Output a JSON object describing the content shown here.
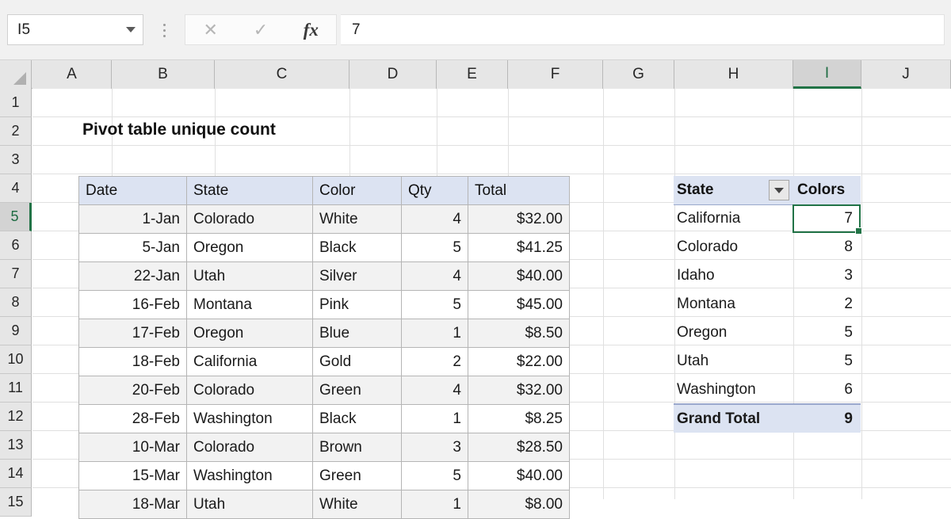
{
  "app": {
    "name_box_value": "I5",
    "formula_bar_value": "7",
    "cancel_icon": "close-icon",
    "confirm_icon": "check-icon",
    "function_icon": "fx-icon",
    "accent_color": "#217346",
    "header_fill": "#dce3f2"
  },
  "grid": {
    "columns": [
      "A",
      "B",
      "C",
      "D",
      "E",
      "F",
      "G",
      "H",
      "I",
      "J"
    ],
    "active_column": "I",
    "rows": [
      "1",
      "2",
      "3",
      "4",
      "5",
      "6",
      "7",
      "8",
      "9",
      "10",
      "11",
      "12",
      "13",
      "14",
      "15"
    ],
    "active_row": "5"
  },
  "title": "Pivot table unique count",
  "data_table": {
    "headers": [
      "Date",
      "State",
      "Color",
      "Qty",
      "Total"
    ],
    "rows": [
      [
        "1-Jan",
        "Colorado",
        "White",
        "4",
        "$32.00"
      ],
      [
        "5-Jan",
        "Oregon",
        "Black",
        "5",
        "$41.25"
      ],
      [
        "22-Jan",
        "Utah",
        "Silver",
        "4",
        "$40.00"
      ],
      [
        "16-Feb",
        "Montana",
        "Pink",
        "5",
        "$45.00"
      ],
      [
        "17-Feb",
        "Oregon",
        "Blue",
        "1",
        "$8.50"
      ],
      [
        "18-Feb",
        "California",
        "Gold",
        "2",
        "$22.00"
      ],
      [
        "20-Feb",
        "Colorado",
        "Green",
        "4",
        "$32.00"
      ],
      [
        "28-Feb",
        "Washington",
        "Black",
        "1",
        "$8.25"
      ],
      [
        "10-Mar",
        "Colorado",
        "Brown",
        "3",
        "$28.50"
      ],
      [
        "15-Mar",
        "Washington",
        "Green",
        "5",
        "$40.00"
      ],
      [
        "18-Mar",
        "Utah",
        "White",
        "1",
        "$8.00"
      ]
    ]
  },
  "pivot_table": {
    "headers": [
      "State",
      "Colors"
    ],
    "filter_icon": "filter-dropdown-icon",
    "rows": [
      [
        "California",
        "7"
      ],
      [
        "Colorado",
        "8"
      ],
      [
        "Idaho",
        "3"
      ],
      [
        "Montana",
        "2"
      ],
      [
        "Oregon",
        "5"
      ],
      [
        "Utah",
        "5"
      ],
      [
        "Washington",
        "6"
      ]
    ],
    "grand_total": [
      "Grand Total",
      "9"
    ]
  }
}
